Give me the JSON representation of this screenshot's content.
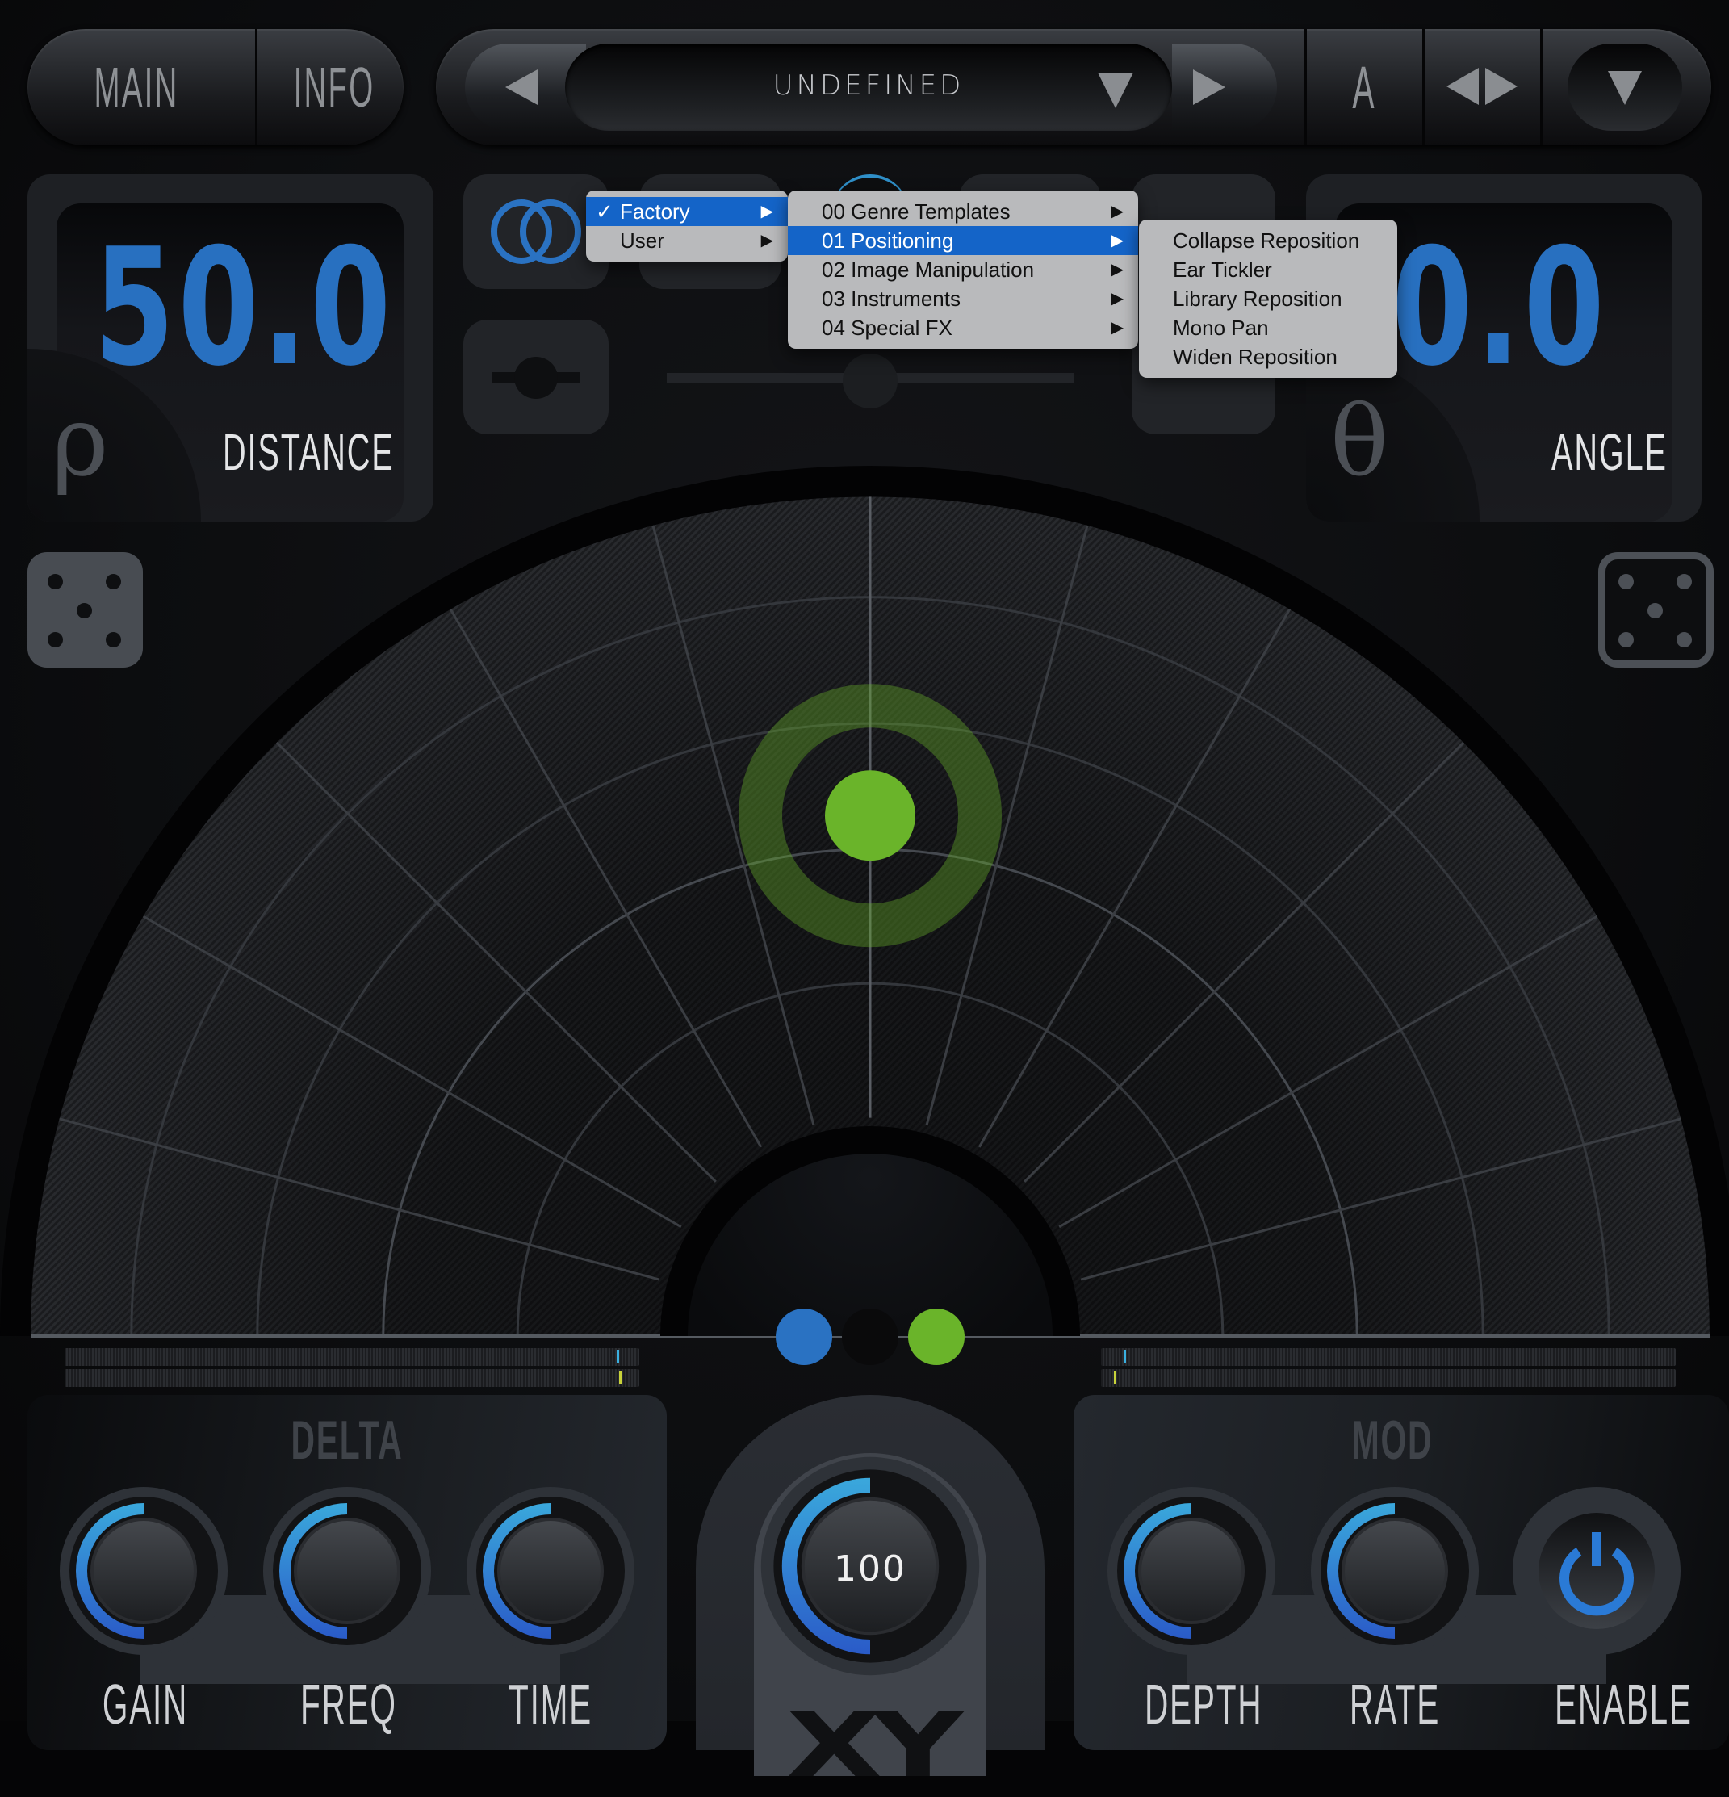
{
  "header": {
    "tabs": [
      {
        "label": "MAIN"
      },
      {
        "label": "INFO"
      }
    ],
    "preset": {
      "name": "UNDEFINED",
      "prev_icon": "triangle-left-icon",
      "next_icon": "triangle-right-icon",
      "dropdown_icon": "triangle-down-icon"
    },
    "ab_label": "A",
    "compare_icon": "left-right-arrows-icon",
    "options_icon": "triangle-down-icon"
  },
  "distance": {
    "value": "50.0",
    "symbol": "ρ",
    "label": "DISTANCE"
  },
  "angle": {
    "value": "0.0",
    "symbol": "θ",
    "label": "ANGLE"
  },
  "mode_icons": {
    "link": "linked-rings-icon",
    "center": "center-slider-icon"
  },
  "preset_menu": {
    "level1": [
      {
        "label": "Factory",
        "checked": true,
        "selected": true,
        "submenu": true
      },
      {
        "label": "User",
        "checked": false,
        "selected": false,
        "submenu": true
      }
    ],
    "level2": [
      {
        "label": "00 Genre Templates",
        "selected": false,
        "submenu": true
      },
      {
        "label": "01 Positioning",
        "selected": true,
        "submenu": true
      },
      {
        "label": "02 Image Manipulation",
        "selected": false,
        "submenu": true
      },
      {
        "label": "03 Instruments",
        "selected": false,
        "submenu": true
      },
      {
        "label": "04 Special FX",
        "selected": false,
        "submenu": true
      }
    ],
    "level3": [
      {
        "label": "Collapse Reposition"
      },
      {
        "label": "Ear Tickler"
      },
      {
        "label": "Library Reposition"
      },
      {
        "label": "Mono Pan"
      },
      {
        "label": "Widen Reposition"
      }
    ],
    "checkmark": "✓",
    "arrow": "▶"
  },
  "randomize": {
    "left_icon": "dice-five-filled-icon",
    "right_icon": "dice-five-outline-icon"
  },
  "panner": {
    "distance_percent": 50,
    "angle_degrees": 0,
    "source_indicators": [
      {
        "name": "left",
        "color": "#2a72c2"
      },
      {
        "name": "center",
        "color": "#0a0a0b"
      },
      {
        "name": "right",
        "color": "#6ab42a"
      }
    ],
    "puck_color": "#6ab42a"
  },
  "meters": {
    "left_marker_fraction": 0.96,
    "right_marker_fraction": 0.04
  },
  "delta": {
    "title": "DELTA",
    "knobs": [
      {
        "label": "GAIN",
        "value_fraction": 0.5
      },
      {
        "label": "FREQ",
        "value_fraction": 0.5
      },
      {
        "label": "TIME",
        "value_fraction": 0.5
      }
    ]
  },
  "output": {
    "value": "100",
    "value_fraction": 0.5,
    "logo": "XY"
  },
  "mod": {
    "title": "MOD",
    "knobs": [
      {
        "label": "DEPTH",
        "value_fraction": 0.5
      },
      {
        "label": "RATE",
        "value_fraction": 0.5
      }
    ],
    "enable": {
      "label": "ENABLE",
      "icon": "power-icon",
      "on": true
    }
  },
  "colors": {
    "accent_blue": "#2870c0",
    "arc_top": "#3aa8dc",
    "arc_bottom": "#2a5bc8",
    "green": "#6ab42a",
    "menu_highlight": "#1464c8"
  }
}
